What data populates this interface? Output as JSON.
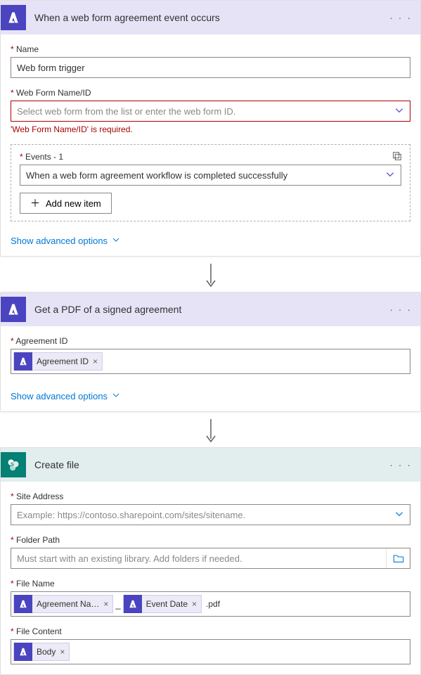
{
  "step1": {
    "title": "When a web form agreement event occurs",
    "name_label": "Name",
    "name_value": "Web form trigger",
    "webform_label": "Web Form Name/ID",
    "webform_placeholder": "Select web form from the list or enter the web form ID.",
    "webform_error": "'Web Form Name/ID' is required.",
    "events_label": "Events - 1",
    "events_value": "When a web form agreement workflow is completed successfully",
    "add_item": "Add new item",
    "advanced": "Show advanced options"
  },
  "step2": {
    "title": "Get a PDF of a signed agreement",
    "agreement_label": "Agreement ID",
    "agreement_token": "Agreement ID",
    "advanced": "Show advanced options"
  },
  "step3": {
    "title": "Create file",
    "site_label": "Site Address",
    "site_placeholder": "Example: https://contoso.sharepoint.com/sites/sitename.",
    "folder_label": "Folder Path",
    "folder_placeholder": "Must start with an existing library. Add folders if needed.",
    "filename_label": "File Name",
    "filename_token1": "Agreement Na…",
    "filename_token2": "Event Date",
    "filename_suffix": ".pdf",
    "filecontent_label": "File Content",
    "filecontent_token": "Body"
  }
}
